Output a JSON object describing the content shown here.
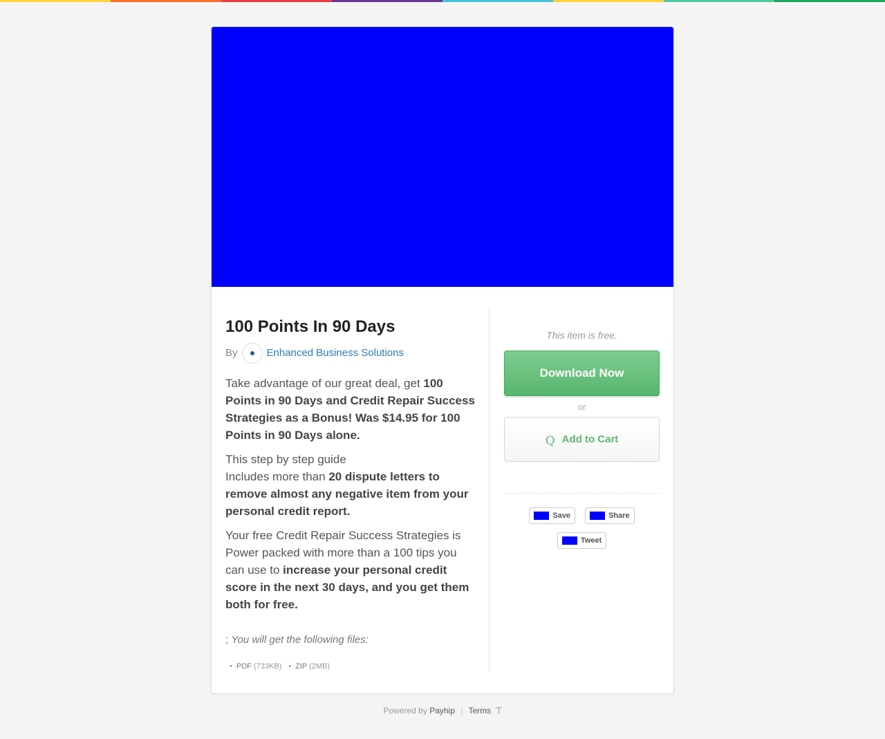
{
  "colors": {
    "strip": [
      "#fdd13a",
      "#f76b2b",
      "#ee3a45",
      "#6a3597",
      "#46c1d4",
      "#fdd13a",
      "#4bcb9b",
      "#19a35b"
    ],
    "cover": "#0000ff",
    "download_button": "#5cb870",
    "seller_link": "#2f7ab8"
  },
  "product": {
    "title": "100 Points In 90 Days",
    "by_label": "By",
    "seller_name": "Enhanced Business Solutions",
    "description": {
      "p1_text": "Take advantage of our great deal, get ",
      "p1_bold": "100 Points in 90 Days and Credit Repair Success Strategies as a Bonus! Was $14.95 for 100 Points in 90 Days alone.",
      "p2_line1": "This step by step guide",
      "p2_text": "Includes more than ",
      "p2_bold": "20 dispute letters to remove almost any negative item from your personal credit report.",
      "p3_text": "Your free Credit Repair Success Strategies is Power packed with more than a 100 tips you can use to ",
      "p3_bold": "increase your personal credit score in the next 30 days, and you get them both for free."
    },
    "files_intro_prefix": ";",
    "files_intro": "You will get the following files:",
    "files": [
      {
        "type": "PDF",
        "size": "(733KB)"
      },
      {
        "type": "ZIP",
        "size": "(2MB)"
      }
    ]
  },
  "sidebar": {
    "free_note": "This item is free.",
    "download_label": "Download Now",
    "or_label": "or",
    "cart_icon": "cart-icon",
    "cart_icon_glyph": "Q",
    "cart_label": "Add to Cart",
    "social": {
      "save_label": "Save",
      "share_label": "Share",
      "tweet_label": "Tweet"
    }
  },
  "footer": {
    "powered_by": "Powered by",
    "payhip": "Payhip",
    "separator": "|",
    "terms": "Terms",
    "terms_glyph": "T"
  }
}
